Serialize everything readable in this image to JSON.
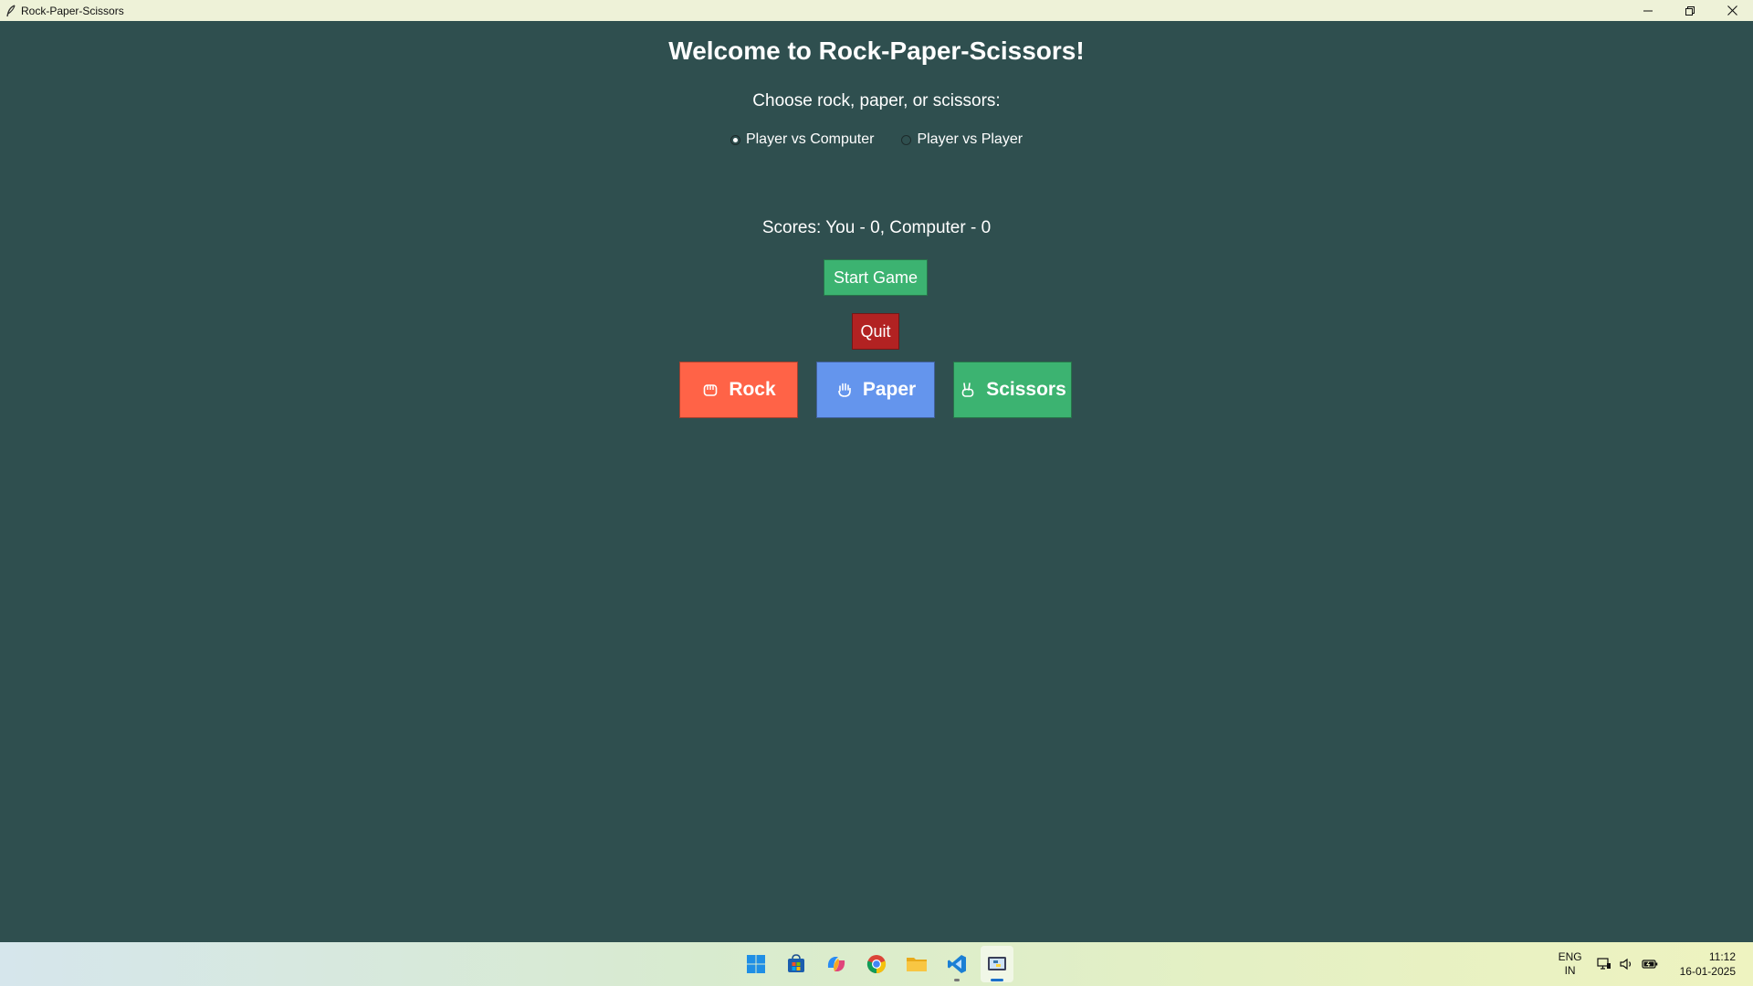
{
  "window": {
    "title": "Rock-Paper-Scissors"
  },
  "game": {
    "heading": "Welcome to Rock-Paper-Scissors!",
    "prompt": "Choose rock, paper, or scissors:",
    "modes": [
      {
        "label": "Player vs Computer",
        "selected": true
      },
      {
        "label": "Player vs Player",
        "selected": false
      }
    ],
    "scores": "Scores: You - 0, Computer - 0",
    "start_label": "Start Game",
    "quit_label": "Quit",
    "choices": {
      "rock": {
        "label": "Rock",
        "icon": "fist-icon",
        "color": "#ff6347"
      },
      "paper": {
        "label": "Paper",
        "icon": "open-hand-icon",
        "color": "#6495ed"
      },
      "scissors": {
        "label": "Scissors",
        "icon": "peace-hand-icon",
        "color": "#3cb371"
      }
    },
    "colors": {
      "background": "#2f4f4f",
      "start": "#3cb371",
      "quit": "#b22222"
    }
  },
  "taskbar": {
    "apps": [
      {
        "name": "start-icon"
      },
      {
        "name": "store-icon"
      },
      {
        "name": "copilot-icon"
      },
      {
        "name": "chrome-icon"
      },
      {
        "name": "file-explorer-icon"
      },
      {
        "name": "vscode-icon"
      },
      {
        "name": "python-icon",
        "active": true
      }
    ],
    "tray": {
      "lang_line1": "ENG",
      "lang_line2": "IN",
      "time": "11:12",
      "date": "16-01-2025"
    }
  }
}
